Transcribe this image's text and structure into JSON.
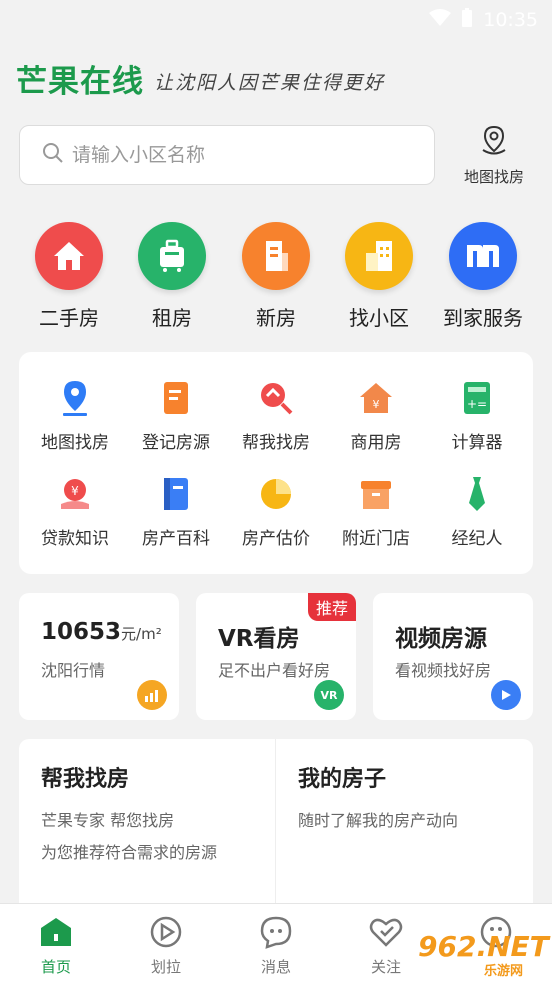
{
  "status": {
    "time": "10:35"
  },
  "header": {
    "logo": "芒果在线",
    "slogan": "让沈阳人因芒果住得更好"
  },
  "search": {
    "placeholder": "请输入小区名称",
    "map_find": "地图找房"
  },
  "categories": [
    {
      "label": "二手房",
      "color": "#ef4c4c",
      "icon": "house-icon"
    },
    {
      "label": "租房",
      "color": "#27b36a",
      "icon": "suitcase-icon"
    },
    {
      "label": "新房",
      "color": "#f7822d",
      "icon": "building-icon"
    },
    {
      "label": "找小区",
      "color": "#f7b614",
      "icon": "buildings-icon"
    },
    {
      "label": "到家服务",
      "color": "#2e6df5",
      "icon": "service-logo-icon"
    }
  ],
  "tools": [
    {
      "label": "地图找房",
      "icon": "map-pin-icon"
    },
    {
      "label": "登记房源",
      "icon": "register-icon"
    },
    {
      "label": "帮我找房",
      "icon": "search-house-icon"
    },
    {
      "label": "商用房",
      "icon": "commercial-icon"
    },
    {
      "label": "计算器",
      "icon": "calculator-icon"
    },
    {
      "label": "贷款知识",
      "icon": "loan-icon"
    },
    {
      "label": "房产百科",
      "icon": "book-icon"
    },
    {
      "label": "房产估价",
      "icon": "pie-icon"
    },
    {
      "label": "附近门店",
      "icon": "store-icon"
    },
    {
      "label": "经纪人",
      "icon": "tie-icon"
    }
  ],
  "quick": [
    {
      "title": "10653",
      "unit": "元/m²",
      "sub": "沈阳行情",
      "icon_color": "#f5a623"
    },
    {
      "title": "VR看房",
      "sub": "足不出户看好房",
      "badge": "推荐",
      "icon_text": "VR",
      "icon_color": "#27b36a"
    },
    {
      "title": "视频房源",
      "sub": "看视频找好房",
      "icon_color": "#3a7ef5"
    }
  ],
  "big_cards": [
    {
      "title": "帮我找房",
      "line1": "芒果专家 帮您找房",
      "line2": "为您推荐符合需求的房源"
    },
    {
      "title": "我的房子",
      "line1": "随时了解我的房产动向",
      "line2": ""
    }
  ],
  "tabs": [
    {
      "label": "首页",
      "active": true
    },
    {
      "label": "划拉",
      "active": false
    },
    {
      "label": "消息",
      "active": false
    },
    {
      "label": "关注",
      "active": false
    },
    {
      "label": "",
      "active": false
    }
  ],
  "watermark": {
    "text": "962.NET",
    "sub": "乐游网"
  },
  "colors": {
    "brand": "#1c9a4c",
    "badge": "#e6323b"
  }
}
